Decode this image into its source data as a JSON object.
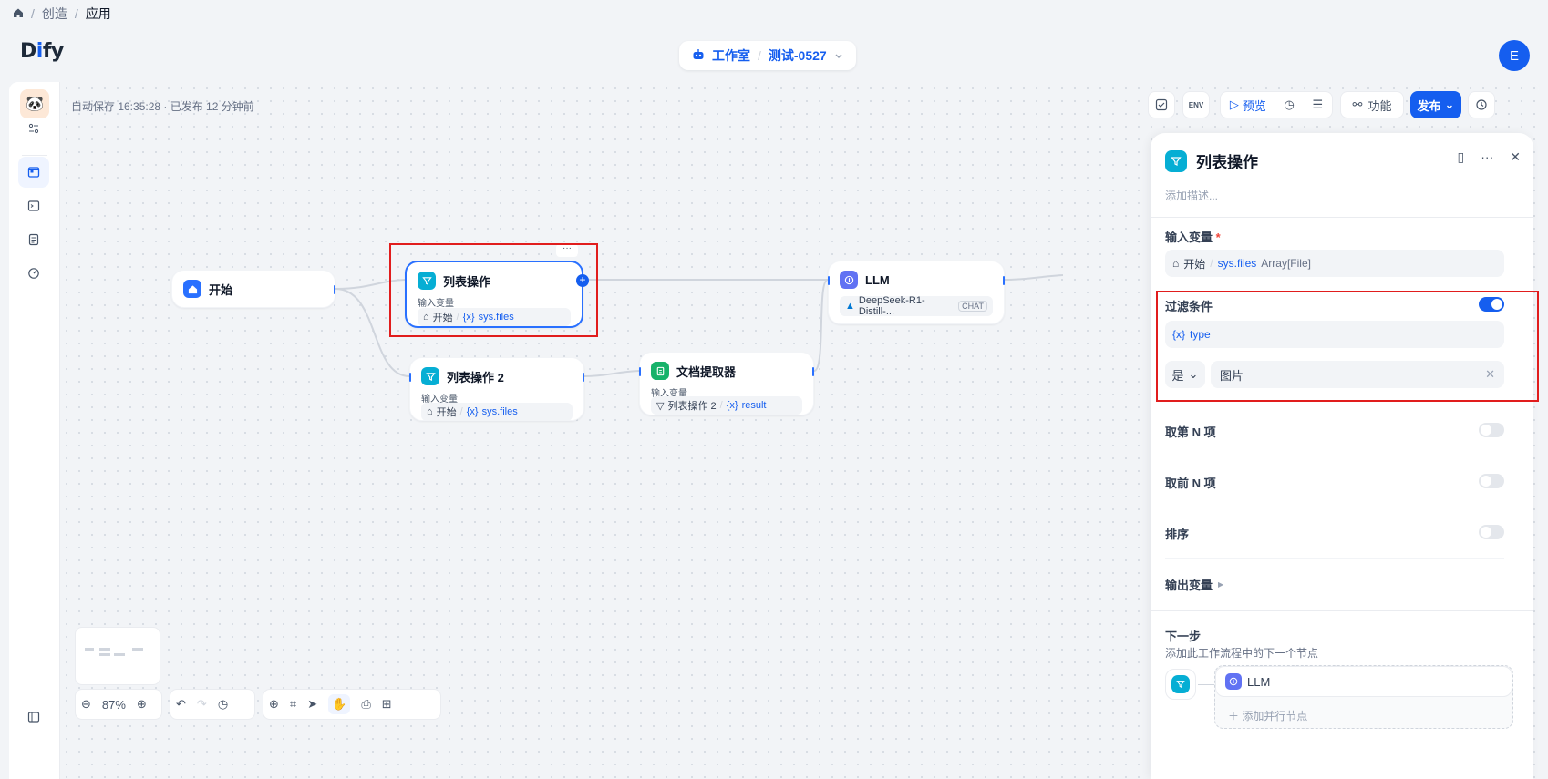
{
  "breadcrumb": {
    "sep1": "/",
    "create": "创造",
    "sep2": "/",
    "app": "应用"
  },
  "header": {
    "logo_d": "D",
    "logo_i": "i",
    "logo_fy": "fy",
    "workspace": "工作室",
    "app_name": "测试-0527",
    "avatar": "E"
  },
  "canvas": {
    "autosave": "自动保存 16:35:28 · 已发布 12 分钟前"
  },
  "toolbar": {
    "preview": "预览",
    "features": "功能",
    "publish": "发布",
    "env": "ENV"
  },
  "nodes": {
    "start": {
      "title": "开始"
    },
    "list_op": {
      "title": "列表操作",
      "sub": "输入变量",
      "var_node": "开始",
      "var_name": "sys.files",
      "more": "···"
    },
    "list_op2": {
      "title": "列表操作 2",
      "sub": "输入变量",
      "var_node": "开始",
      "var_name": "sys.files"
    },
    "doc_extractor": {
      "title": "文档提取器",
      "sub": "输入变量",
      "var_node": "列表操作 2",
      "var_name": "result"
    },
    "llm": {
      "title": "LLM",
      "model": "DeepSeek-R1-Distill-...",
      "mode": "CHAT"
    }
  },
  "panel": {
    "title": "列表操作",
    "desc_placeholder": "添加描述...",
    "input_label": "输入变量",
    "required": "*",
    "input_node": "开始",
    "input_var": "sys.files",
    "input_type": "Array[File]",
    "filter_label": "过滤条件",
    "filter_on": true,
    "filter_var": "type",
    "filter_op": "是",
    "filter_value": "图片",
    "take_nth": "取第 N 项",
    "take_first": "取前 N 项",
    "sort": "排序",
    "output": "输出变量",
    "next_label": "下一步",
    "next_desc": "添加此工作流程中的下一个节点",
    "next_node": "LLM",
    "add_parallel": "添加并行节点"
  },
  "controls": {
    "zoom": "87%"
  }
}
